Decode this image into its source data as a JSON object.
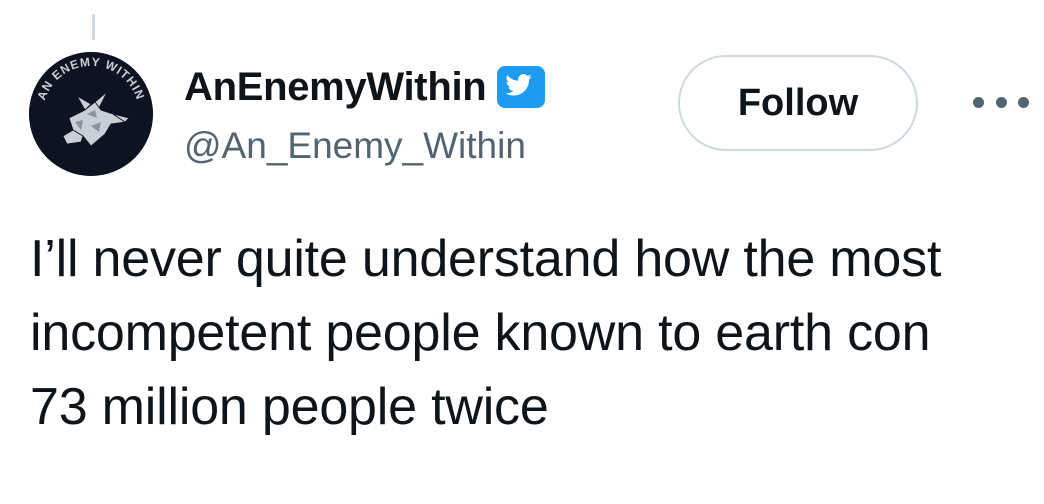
{
  "author": {
    "display_name": "AnEnemyWithin",
    "handle": "@An_Enemy_Within",
    "avatar_text": "AN ENEMY WITHIN",
    "avatar_icon": "wolf-emblem-icon",
    "verified_icon": "verified-badge-icon"
  },
  "actions": {
    "follow_label": "Follow",
    "more_icon": "more-options-icon"
  },
  "tweet": {
    "text": "I’ll never quite understand how the most\nincompetent people known to earth con\n73 million people twice"
  },
  "colors": {
    "text_primary": "#0f1419",
    "text_secondary": "#536471",
    "border": "#cfd9de",
    "verified_blue": "#1d9bf0",
    "avatar_bg": "#0b1420"
  }
}
